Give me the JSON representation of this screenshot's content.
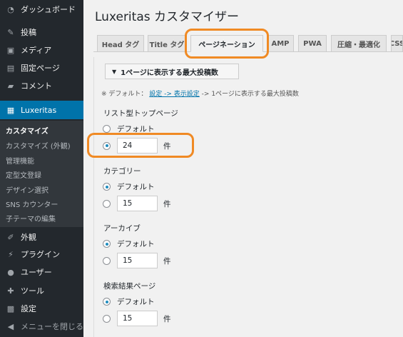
{
  "sidebar": {
    "dashboard": "ダッシュボード",
    "posts": "投稿",
    "media": "メディア",
    "pages": "固定ページ",
    "comments": "コメント",
    "luxeritas": "Luxeritas",
    "submenu": [
      "カスタマイズ",
      "カスタマイズ (外観)",
      "管理機能",
      "定型文登録",
      "デザイン選択",
      "SNS カウンター",
      "子テーマの編集"
    ],
    "appearance": "外観",
    "plugins": "プラグイン",
    "users": "ユーザー",
    "tools": "ツール",
    "settings": "設定",
    "collapse": "メニューを閉じる"
  },
  "main": {
    "title": "Luxeritas カスタマイザー",
    "tabs": [
      "Head タグ",
      "Title タグ",
      "ページネーション",
      "AMP",
      "PWA",
      "圧縮・最適化",
      "CSS"
    ],
    "section_header": "1ページに表示する最大投稿数",
    "note_prefix": "※ デフォルト：",
    "note_link": "設定 -> 表示設定",
    "note_suffix": " -> 1ページに表示する最大投稿数",
    "groups": [
      {
        "title": "リスト型トップページ",
        "default_label": "デフォルト",
        "value": "24",
        "unit": "件",
        "selected": "custom"
      },
      {
        "title": "カテゴリー",
        "default_label": "デフォルト",
        "value": "15",
        "unit": "件",
        "selected": "default"
      },
      {
        "title": "アーカイブ",
        "default_label": "デフォルト",
        "value": "15",
        "unit": "件",
        "selected": "default"
      },
      {
        "title": "検索結果ページ",
        "default_label": "デフォルト",
        "value": "15",
        "unit": "件",
        "selected": "default"
      }
    ]
  },
  "colors": {
    "sidebar_bg": "#23282d",
    "accent": "#0073aa",
    "highlight": "#f08a24"
  }
}
